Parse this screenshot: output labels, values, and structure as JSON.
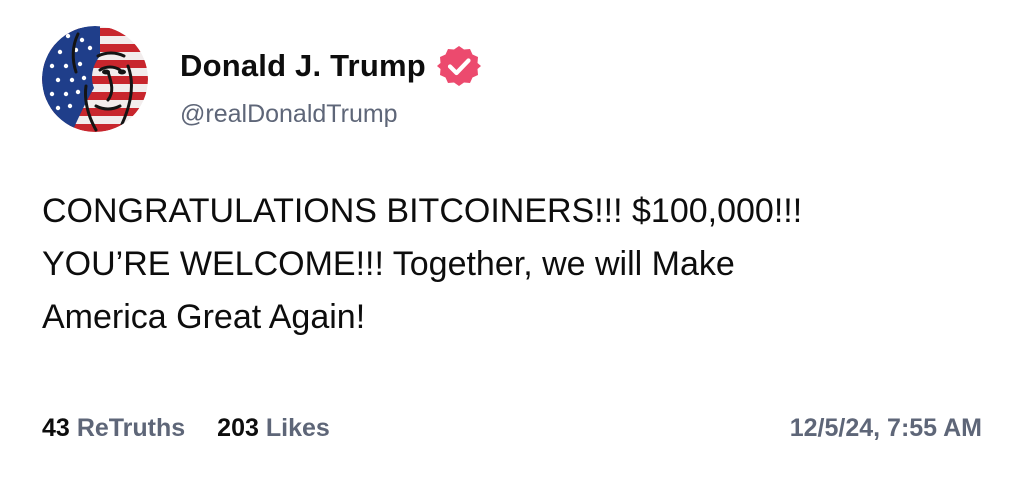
{
  "post": {
    "author": {
      "display_name": "Donald J. Trump",
      "handle": "@realDonaldTrump",
      "verified": true,
      "verified_icon": "verified-badge-icon",
      "avatar_icon": "american-flag-face-avatar"
    },
    "body_lines": [
      "CONGRATULATIONS BITCOINERS!!! $100,000!!!",
      "YOU’RE WELCOME!!! Together, we will Make",
      "America Great Again!"
    ],
    "stats": {
      "retruths_count": "43",
      "retruths_label": "ReTruths",
      "likes_count": "203",
      "likes_label": "Likes"
    },
    "timestamp": "12/5/24, 7:55 AM"
  },
  "colors": {
    "text_primary": "#0d0d0d",
    "text_secondary": "#5e6678",
    "badge": "#ec4a6e",
    "background": "#ffffff"
  }
}
